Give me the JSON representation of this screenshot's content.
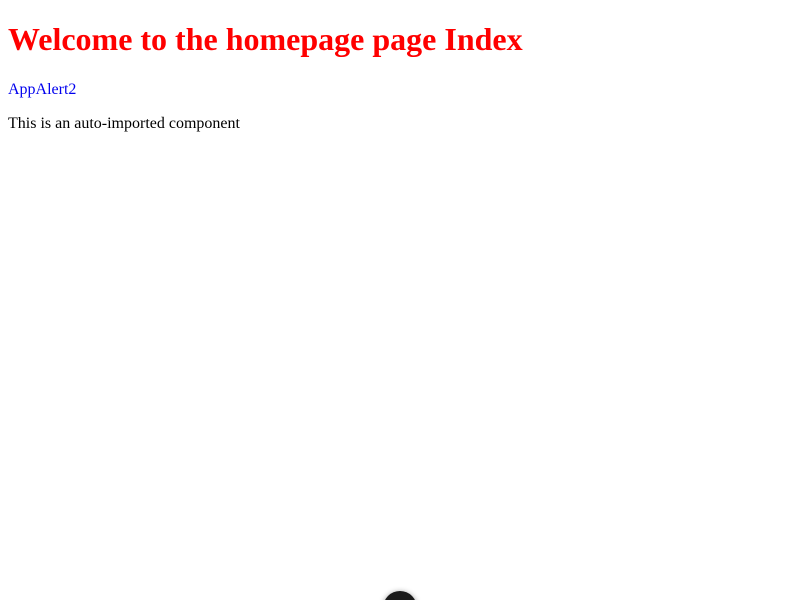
{
  "page": {
    "heading": "Welcome to the homepage page Index",
    "heading_color": "#ff0000",
    "alert_link_label": "AppAlert2",
    "alert_link_color": "#0000ee",
    "description": "This is an auto-imported component"
  },
  "devtools": {
    "icon": "nuxt-logo-icon",
    "background_color": "#1a1a1a",
    "icon_color": "#9a9a9a"
  }
}
